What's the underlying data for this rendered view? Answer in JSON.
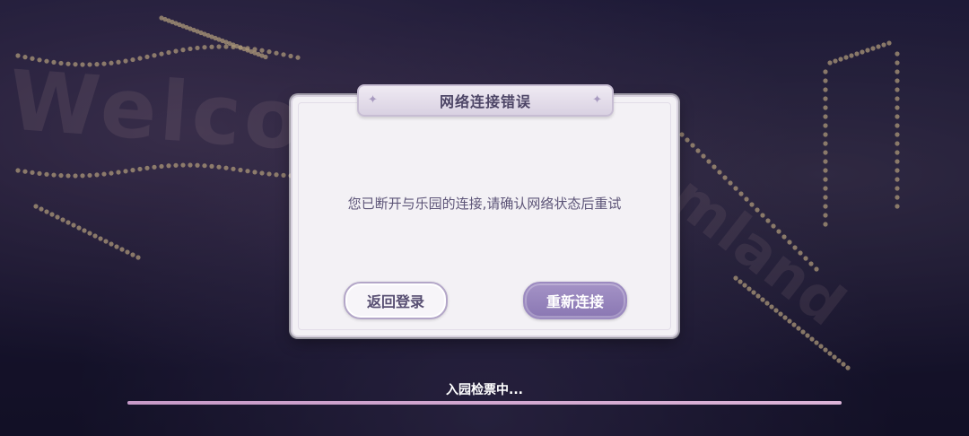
{
  "background": {
    "sign_text": "Welco",
    "sign_text_2": "amland"
  },
  "dialog": {
    "title": "网络连接错误",
    "message": "您已断开与乐园的连接,请确认网络状态后重试",
    "back_button_label": "返回登录",
    "retry_button_label": "重新连接",
    "sparkle_icon": "✦"
  },
  "loading": {
    "status_text": "入园检票中...",
    "progress": 1.0
  },
  "colors": {
    "accent": "#8a77b3",
    "progress": "#d4a9d3"
  }
}
